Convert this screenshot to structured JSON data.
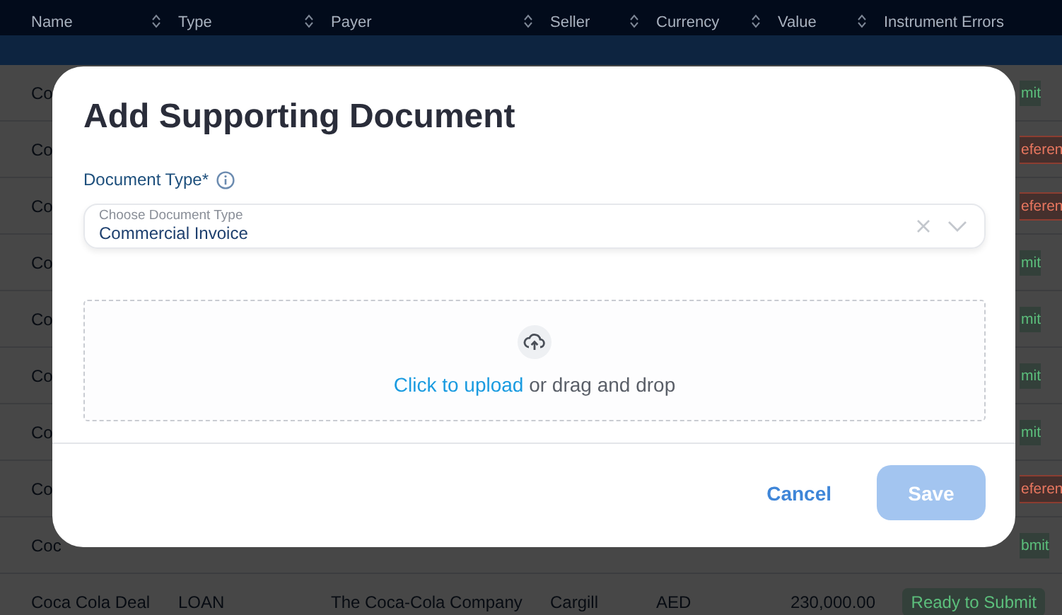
{
  "table": {
    "columns": [
      "Name",
      "Type",
      "Payer",
      "Seller",
      "Currency",
      "Value",
      "Instrument Errors"
    ],
    "rows": [
      {
        "name": "Co",
        "status": "mit",
        "error": false
      },
      {
        "name": "Co",
        "status": "eferen",
        "error": true
      },
      {
        "name": "Co",
        "status": "eferen",
        "error": true
      },
      {
        "name": "Co",
        "status": "mit",
        "error": false
      },
      {
        "name": "Co",
        "status": "mit",
        "error": false
      },
      {
        "name": "Co",
        "status": "mit",
        "error": false
      },
      {
        "name": "Co",
        "status": "mit",
        "error": false
      },
      {
        "name": "Co",
        "status": "eferen",
        "error": true
      },
      {
        "name": "Coc",
        "status": "bmit",
        "error": false
      },
      {
        "name": "Coca Cola Deal",
        "type": "LOAN",
        "payer": "The Coca-Cola Company",
        "seller": "Cargill",
        "currency": "AED",
        "value": "230,000.00",
        "status": "Ready to Submit",
        "error": false
      }
    ]
  },
  "dialog": {
    "title": "Add Supporting Document",
    "field_label": "Document Type*",
    "select": {
      "label": "Choose Document Type",
      "value": "Commercial Invoice"
    },
    "upload": {
      "link": "Click to upload",
      "text": "or drag and drop"
    },
    "buttons": [
      {
        "label": "Cancel",
        "kind": "text",
        "disabled": false
      },
      {
        "label": "Save",
        "kind": "primary",
        "disabled": true
      }
    ]
  }
}
